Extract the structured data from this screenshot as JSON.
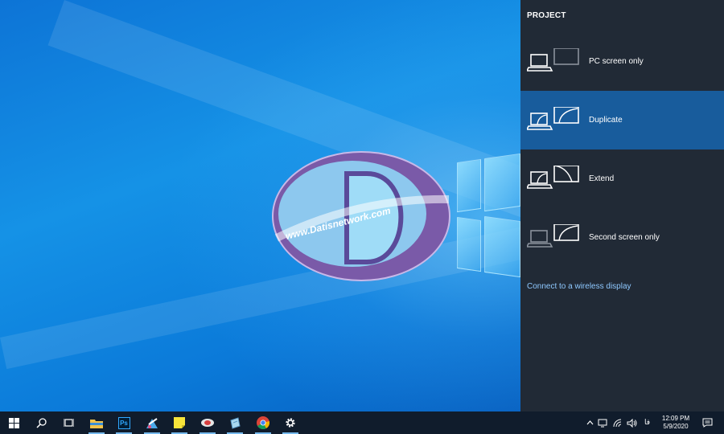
{
  "desktop": {
    "logo_text": "www.Datisnetwork.com",
    "logo_letter": "D"
  },
  "project_panel": {
    "title": "PROJECT",
    "options": [
      {
        "label": "PC screen only",
        "icon": "pc-screen-only-icon",
        "selected": false
      },
      {
        "label": "Duplicate",
        "icon": "duplicate-icon",
        "selected": true
      },
      {
        "label": "Extend",
        "icon": "extend-icon",
        "selected": false
      },
      {
        "label": "Second screen only",
        "icon": "second-screen-only-icon",
        "selected": false
      }
    ],
    "wireless_link": "Connect to a wireless display"
  },
  "taskbar": {
    "apps": [
      "start-icon",
      "search-icon",
      "task-view-icon",
      "file-explorer-icon",
      "photoshop-icon",
      "paint-app-icon",
      "sticky-notes-icon",
      "browser-app-icon",
      "notepad-app-icon",
      "chrome-icon",
      "settings-icon"
    ],
    "photoshop_label": "Ps",
    "tray": {
      "language": "فا",
      "time": "12:09 PM",
      "date": "5/9/2020"
    }
  },
  "colors": {
    "panel_bg": "#212a36",
    "selected_bg": "#185c9c",
    "link": "#8ec8ff",
    "taskbar_bg": "#101c2c"
  }
}
